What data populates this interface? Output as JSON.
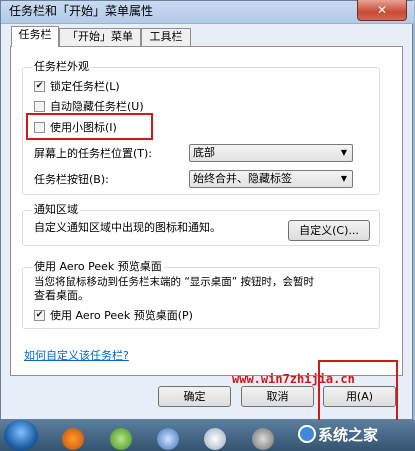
{
  "window": {
    "title": "任务栏和「开始」菜单属性"
  },
  "tabs": [
    "任务栏",
    "「开始」菜单",
    "工具栏"
  ],
  "appearance": {
    "label": "任务栏外观",
    "lock_taskbar": "锁定任务栏(L)",
    "auto_hide": "自动隐藏任务栏(U)",
    "small_icons": "使用小图标(I)",
    "position_label": "屏幕上的任务栏位置(T):",
    "position_value": "底部",
    "buttons_label": "任务栏按钮(B):",
    "buttons_value": "始终合并、隐藏标签"
  },
  "notification": {
    "label": "通知区域",
    "desc": "自定义通知区域中出现的图标和通知。",
    "customize_button": "自定义(C)..."
  },
  "aero": {
    "label": "使用 Aero Peek 预览桌面",
    "desc_line1": "当您将鼠标移动到任务栏末端的 “显示桌面” 按钮时，会暂时",
    "desc_line2": "查看桌面。",
    "checkbox": "使用 Aero Peek 预览桌面(P)"
  },
  "help_link": "如何自定义该任务栏?",
  "buttons": {
    "ok": "确定",
    "cancel": "取消",
    "apply": "用(A)"
  },
  "watermark": {
    "url": "www.win7zhijia.cn",
    "site": "系统之家"
  },
  "colors": {
    "highlight": "#d01a1a",
    "link": "#0066cc"
  }
}
